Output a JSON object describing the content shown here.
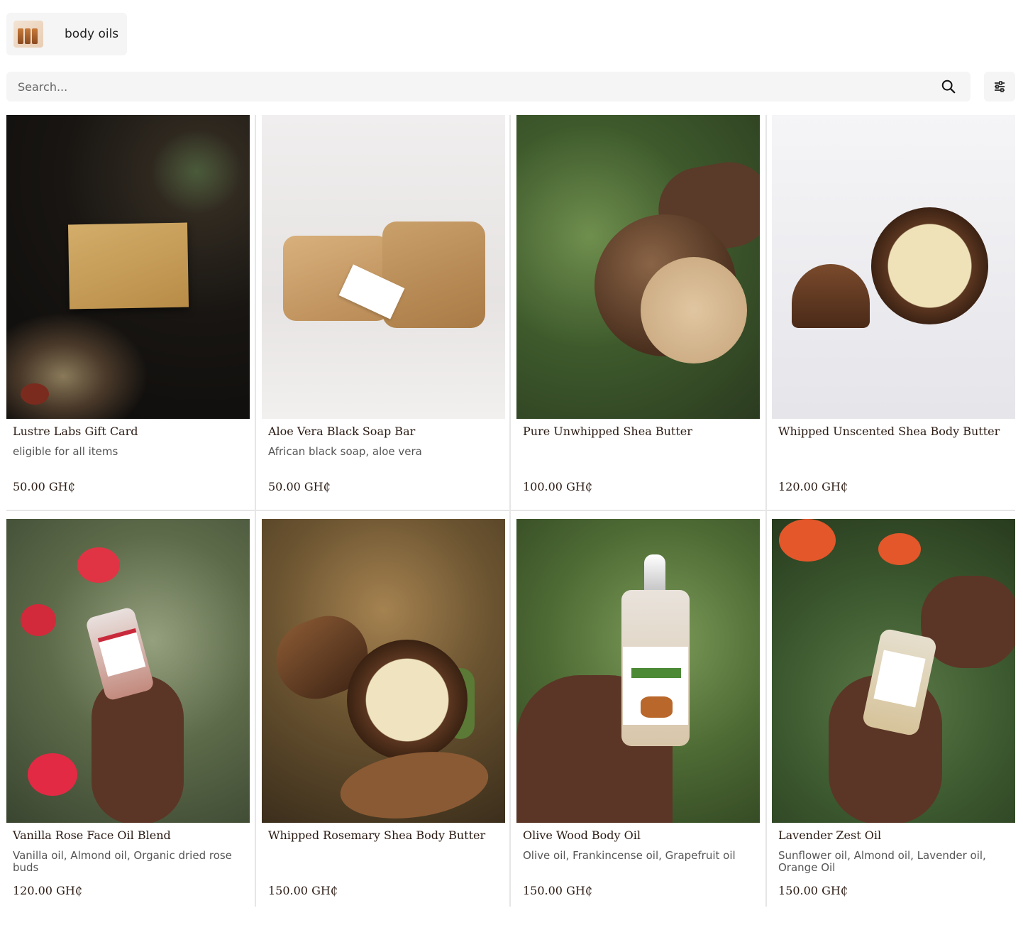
{
  "category": {
    "label": "body oils",
    "thumb_icon": "product-thumbnail"
  },
  "search": {
    "placeholder": "Search..."
  },
  "icons": {
    "search": "search-icon",
    "filter": "sliders-icon"
  },
  "products": [
    {
      "name": "Lustre Labs Gift Card",
      "description": "eligible for all items",
      "price": "50.00 GH₵"
    },
    {
      "name": "Aloe Vera Black Soap Bar",
      "description": "African black soap, aloe vera",
      "price": "50.00 GH₵"
    },
    {
      "name": "Pure Unwhipped Shea Butter",
      "description": "",
      "price": "100.00 GH₵"
    },
    {
      "name": "Whipped Unscented Shea Body Butter",
      "description": "",
      "price": "120.00 GH₵"
    },
    {
      "name": "Vanilla Rose Face Oil Blend",
      "description": "Vanilla oil, Almond oil, Organic dried rose buds",
      "price": "120.00 GH₵"
    },
    {
      "name": "Whipped Rosemary Shea Body Butter",
      "description": "",
      "price": "150.00 GH₵"
    },
    {
      "name": "Olive Wood Body Oil",
      "description": "Olive oil, Frankincense oil, Grapefruit oil",
      "price": "150.00 GH₵"
    },
    {
      "name": "Lavender Zest Oil",
      "description": "Sunflower oil, Almond oil, Lavender oil, Orange Oil",
      "price": "150.00 GH₵"
    }
  ]
}
